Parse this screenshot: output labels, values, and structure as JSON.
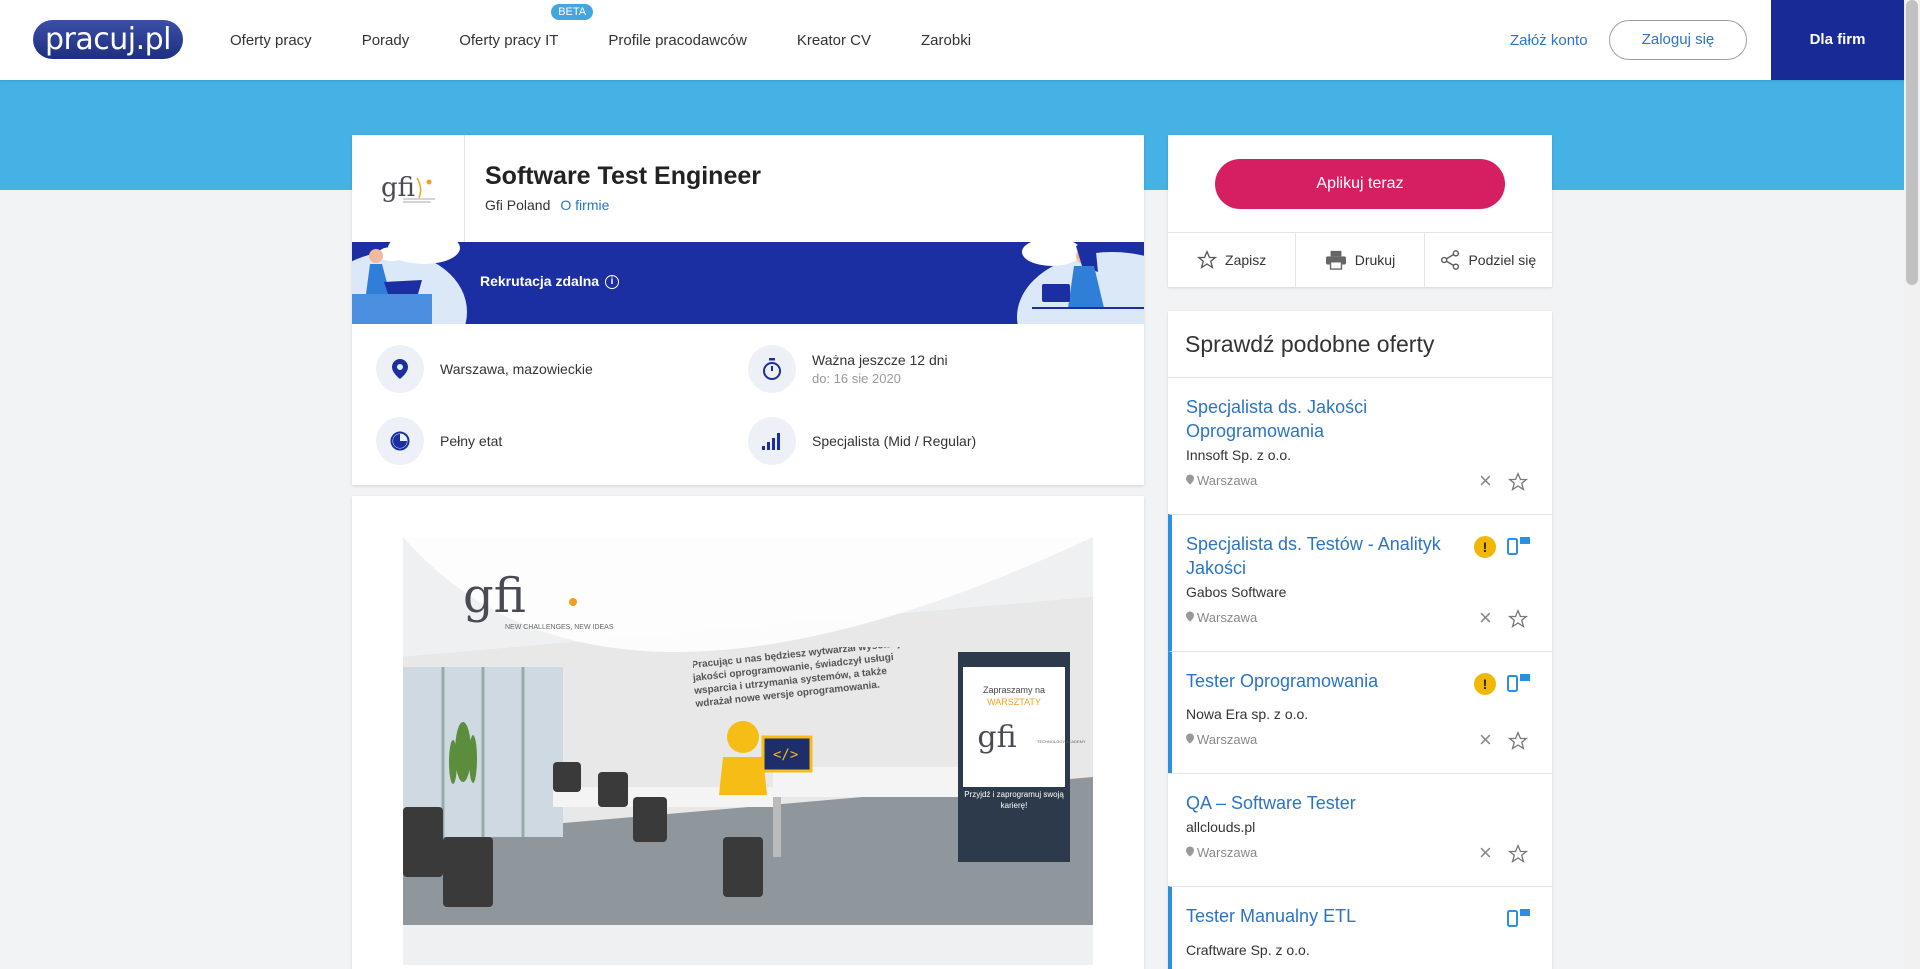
{
  "header": {
    "logo": "pracuj.pl",
    "nav": [
      "Oferty pracy",
      "Porady",
      "Oferty pracy IT",
      "Profile pracodawców",
      "Kreator CV",
      "Zarobki"
    ],
    "beta_badge": "BETA",
    "register": "Załóż konto",
    "login": "Zaloguj się",
    "for_companies": "Dla firm"
  },
  "job": {
    "title": "Software Test Engineer",
    "company": "Gfi Poland",
    "about_link": "O firmie",
    "remote_label": "Rekrutacja zdalna",
    "location": "Warszawa, mazowieckie",
    "validity": "Ważna jeszcze 12 dni",
    "validity_date": "do: 16 sie 2020",
    "employment": "Pełny etat",
    "level": "Specjalista (Mid / Regular)"
  },
  "company_logo_text": "gfi",
  "image_texts": {
    "logo_tag": "NEW CHALLENGES, NEW IDEAS",
    "wall_text": "Pracując u nas będziesz wytwarzał wysokiej jakości oprogramowanie, świadczył usługi wsparcia i utrzymania systemów, a także wdrażał nowe wersje oprogramowania.",
    "poster_invite": "Zapraszamy na",
    "poster_workshops": "WARSZTATY",
    "poster_academy": "TECHNOLOGY ACADEMY",
    "poster_cta": "Przyjdź i zaprogramuj swoją karierę!"
  },
  "sidebar": {
    "apply": "Aplikuj teraz",
    "save": "Zapisz",
    "print": "Drukuj",
    "share": "Podziel się",
    "similar_title": "Sprawdź podobne oferty",
    "offers": [
      {
        "title": "Specjalista ds. Jakości Oprogramowania",
        "company": "Innsoft Sp. z o.o.",
        "location": "Warszawa"
      },
      {
        "title": "Specjalista ds. Testów - Analityk Jakości",
        "company": "Gabos Software",
        "location": "Warszawa"
      },
      {
        "title": "Tester Oprogramowania",
        "company": "Nowa Era sp. z o.o.",
        "location": "Warszawa"
      },
      {
        "title": "QA – Software Tester",
        "company": "allclouds.pl",
        "location": "Warszawa"
      },
      {
        "title": "Tester Manualny ETL",
        "company": "Craftware Sp. z o.o.",
        "location": ""
      }
    ]
  },
  "colors": {
    "brand_blue": "#182a96",
    "accent_pink": "#d61f63",
    "link": "#2b74c4",
    "band": "#44b2e4"
  }
}
